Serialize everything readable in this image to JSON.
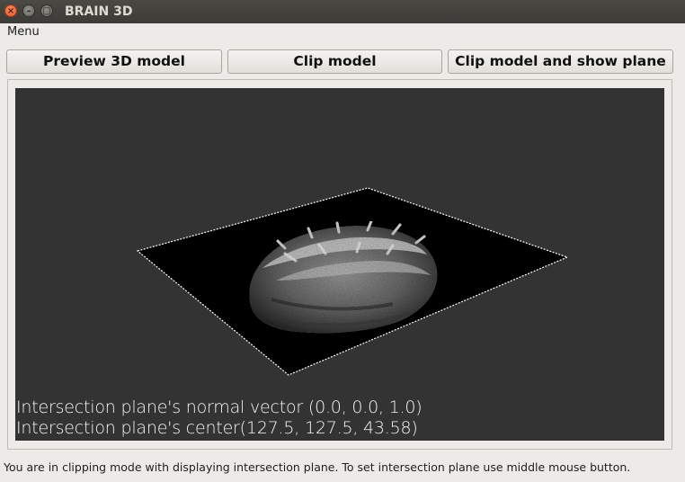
{
  "window": {
    "title": "BRAIN 3D",
    "close_glyph": "×",
    "minimize_glyph": "–",
    "maximize_glyph": "□"
  },
  "menubar": {
    "menu_label": "Menu"
  },
  "toolbar": {
    "preview_label": "Preview 3D model",
    "clip_label": "Clip model",
    "clip_show_plane_label": "Clip model and show plane"
  },
  "viewport": {
    "background": "#333333",
    "plane_color": "#000000",
    "normal_text": "Intersection plane's normal vector (0.0, 0.0, 1.0)",
    "center_text": "Intersection plane's center(127.5, 127.5, 43.58)"
  },
  "status": {
    "text": "You are in clipping mode with displaying intersection plane. To set intersection plane  use middle mouse button."
  },
  "icons": [
    "close-icon",
    "minimize-icon",
    "maximize-icon"
  ]
}
